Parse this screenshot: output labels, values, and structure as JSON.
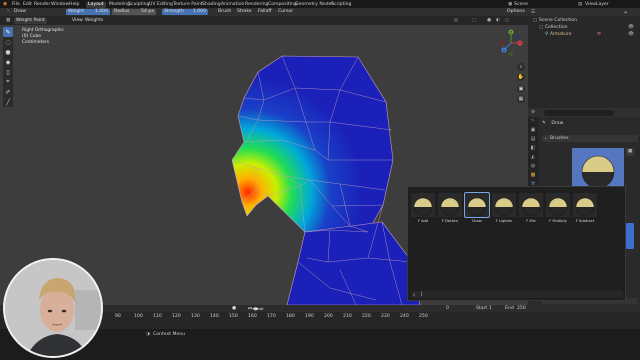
{
  "top_menu": {
    "items": [
      "File",
      "Edit",
      "Render",
      "Window",
      "Help"
    ],
    "workspaces": [
      "Layout",
      "Modeling",
      "Sculpting",
      "UV Editing",
      "Texture Paint",
      "Shading",
      "Animation",
      "Rendering",
      "Compositing",
      "Geometry Nodes",
      "Scripting"
    ],
    "active_workspace": "Layout",
    "scene": "Scene",
    "view_layer": "ViewLayer"
  },
  "tool_header": {
    "tool_name": "Draw",
    "weight_label": "Weight",
    "weight_value": "1.000",
    "radius_label": "Radius",
    "radius_value": "54 px",
    "strength_label": "Strength",
    "strength_value": "1.000",
    "brush_menu": "Brush",
    "stroke_menu": "Stroke",
    "falloff_menu": "Falloff",
    "cursor_menu": "Cursor",
    "options": "Options"
  },
  "view_header": {
    "mode": "Weight Paint",
    "view": "View",
    "weights": "Weights"
  },
  "viewport_overlay": {
    "line1": "Right Orthographic",
    "line2": "(0) Cube",
    "line3": "Centimeters"
  },
  "gizmo": {
    "x": "X",
    "y": "Y",
    "z": "Z"
  },
  "outliner": {
    "root": "Scene Collection",
    "collection": "Collection",
    "object": "Armature"
  },
  "properties": {
    "tool_title": "Draw",
    "brushes_label": "Brushes"
  },
  "brush_picker": {
    "brushes": [
      {
        "label": "F Add",
        "icon": "brush-add-icon"
      },
      {
        "label": "F Darken",
        "icon": "brush-darken-icon"
      },
      {
        "label": "Draw",
        "icon": "brush-draw-icon"
      },
      {
        "label": "F Lighten",
        "icon": "brush-lighten-icon"
      },
      {
        "label": "F Mix",
        "icon": "brush-mix-icon"
      },
      {
        "label": "F Multiply",
        "icon": "brush-multiply-icon"
      },
      {
        "label": "F Subtract",
        "icon": "brush-subtract-icon"
      }
    ],
    "selected": "Draw",
    "search_placeholder": ""
  },
  "timeline": {
    "ticks": [
      "90",
      "100",
      "110",
      "120",
      "130",
      "140",
      "150",
      "160",
      "170",
      "180",
      "190",
      "200",
      "210",
      "220",
      "230",
      "240",
      "250"
    ],
    "current_frame": "0",
    "start_label": "Start",
    "start_value": "1",
    "end_label": "End",
    "end_value": "250"
  },
  "status_bar": {
    "context_menu": "Context Menu"
  },
  "colors": {
    "accent": "#4772b3",
    "mesh_blue": "#1a20b8",
    "wire": "#c89fbd"
  }
}
